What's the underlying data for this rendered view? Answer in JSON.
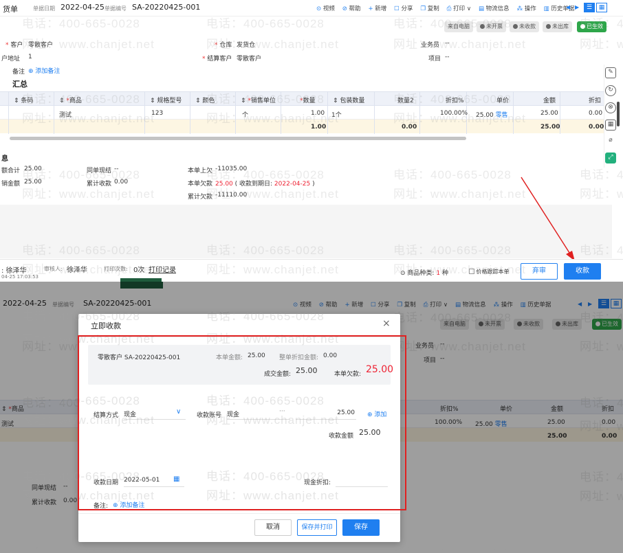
{
  "watermark": {
    "phone": "电话：400-665-0028",
    "url": "网址：www.chanjet.net"
  },
  "top": {
    "title": "货单",
    "date_label": "单据日期",
    "date": "2022-04-25",
    "no_label": "单据编号",
    "no": "SA-20220425-001",
    "toolbar": [
      {
        "icon": "video-icon",
        "label": "视频"
      },
      {
        "icon": "help-icon",
        "label": "帮助"
      },
      {
        "icon": "plus-icon",
        "label": "新增"
      },
      {
        "icon": "share-icon",
        "label": "分享"
      },
      {
        "icon": "copy-icon",
        "label": "复制"
      },
      {
        "icon": "print-icon",
        "label": "打印"
      },
      {
        "icon": "logistics-icon",
        "label": "物流信息"
      },
      {
        "icon": "operate-icon",
        "label": "操作"
      },
      {
        "icon": "history-icon",
        "label": "历史单据"
      }
    ],
    "status": [
      "来自电脑",
      "未开票",
      "未收款",
      "未出库",
      "已生效"
    ],
    "form": {
      "customer_label": "客户",
      "customer": "零散客户",
      "warehouse_label": "仓库",
      "warehouse": "发货仓",
      "salesman_label": "业务员",
      "salesman": "--",
      "address_label": "户地址",
      "address": "1",
      "settle_label": "结算客户",
      "settle": "零散客户",
      "project_label": "项目",
      "project": "--",
      "note_label": "备注",
      "note_add": "添加备注"
    },
    "section": "汇总",
    "table": {
      "headers": [
        "条码",
        "商品",
        "规格型号",
        "颜色",
        "销售单位",
        "数量",
        "包装数量",
        "数量2",
        "折扣%",
        "单价",
        "金额",
        "折扣"
      ],
      "row": {
        "product": "测试",
        "spec": "123",
        "unit": "个",
        "qty": "1.00",
        "pack": "1个",
        "discount": "100.00%",
        "price": "25.00",
        "price_tag": "零售",
        "amount": "25.00",
        "disc": "0.00"
      },
      "total": {
        "qty": "1.00",
        "qty2": "0.00",
        "amount": "25.00",
        "disc": "0.00"
      }
    },
    "info_title": "息",
    "info": {
      "sum_label": "额合计",
      "sum": "25.00",
      "same_cash_label": "同单现结",
      "same_cash": "--",
      "last_label": "本单上欠",
      "last": "-11035.00",
      "sale_label": "销金额",
      "sale": "25.00",
      "acc_recv_label": "累计收款",
      "acc_recv": "0.00",
      "owe_label": "本单欠款",
      "owe": "25.00",
      "owe_note_a": "( 收款到期日:",
      "owe_date": "2022-04-25",
      "owe_note_b": ")",
      "acc_owe_label": "累计欠款",
      "acc_owe": "-11110.00"
    },
    "footer": {
      "maker": "徐泽华",
      "auditor_label": "审核人:",
      "auditor": "徐泽华",
      "print_label": "打印次数:",
      "print_count": "0次",
      "print_log": "打印记录",
      "datetime": "04-25 17:03:53",
      "kinds_label": "商品种类:",
      "kinds": "1",
      "kinds_unit": "种",
      "follow": "价格跟踪本单",
      "abandon": "弃审",
      "collect": "收款"
    }
  },
  "bottom": {
    "date": "2022-04-25",
    "no_label": "单据编号",
    "no": "SA-20220425-001",
    "bg_left": {
      "product_col": "商品",
      "product": "测试",
      "same_cash_label": "同单现结",
      "same_cash": "--",
      "acc_recv_label": "累计收款",
      "acc_recv": "0.00"
    },
    "bg_right": {
      "salesman_label": "业务员",
      "salesman": "--",
      "project_label": "项目",
      "project": "--",
      "headers": [
        "折扣%",
        "单价",
        "金额",
        "折扣"
      ],
      "discount": "100.00%",
      "price": "25.00",
      "price_tag": "零售",
      "amount": "25.00",
      "disc": "0.00",
      "total_amount": "25.00",
      "total_disc": "0.00"
    },
    "dialog": {
      "title": "立即收款",
      "customer": "零散客户 SA-20220425-001",
      "bill_amount_label": "本单金额:",
      "bill_amount": "25.00",
      "whole_disc_label": "整单折扣金额:",
      "whole_disc": "0.00",
      "deal_label": "成交金额:",
      "deal": "25.00",
      "owe_label": "本单欠款:",
      "owe": "25.00",
      "method_label": "结算方式",
      "method": "现金",
      "account_label": "收款账号",
      "account": "现金",
      "account_amount": "25.00",
      "add": "添加",
      "recv_label": "收款金额",
      "recv": "25.00",
      "date_label": "收款日期",
      "date": "2022-05-01",
      "cash_disc_label": "现金折扣:",
      "note_label": "备注:",
      "note_add": "添加备注",
      "cancel": "取消",
      "save_print": "保存并打印",
      "save": "保存"
    }
  }
}
